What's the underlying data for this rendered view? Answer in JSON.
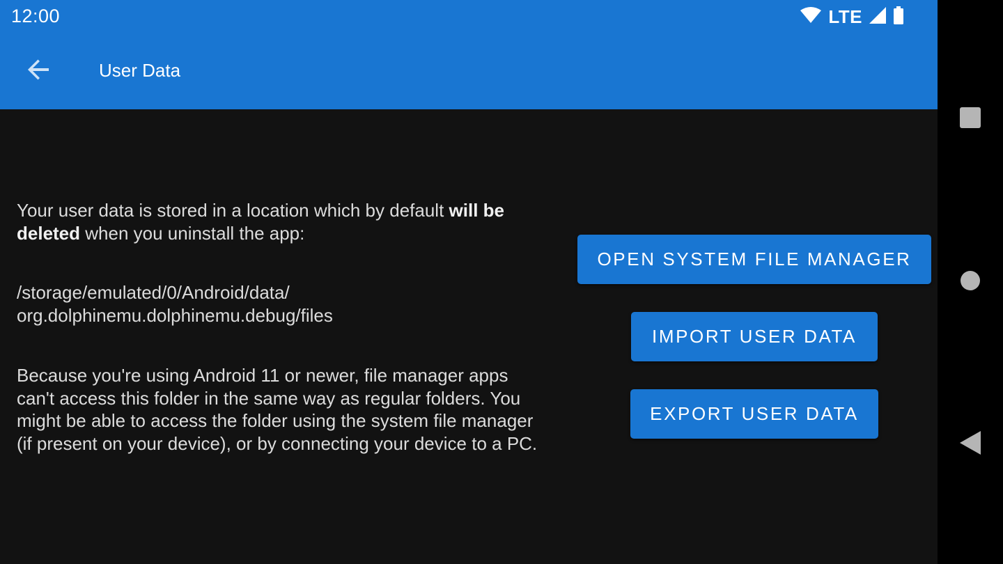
{
  "status_bar": {
    "time": "12:00",
    "network": "LTE",
    "icons": [
      "wifi-icon",
      "cellular-signal-icon",
      "battery-icon"
    ]
  },
  "app_bar": {
    "title": "User Data",
    "back_icon": "arrow-back-icon"
  },
  "content": {
    "intro_prefix": "Your user data is stored in a location which by default ",
    "intro_bold": "will be deleted",
    "intro_suffix": " when you uninstall the app:",
    "path_line1": "/storage/emulated/0/Android/data/",
    "path_line2": "org.dolphinemu.dolphinemu.debug/files",
    "android11_note": "Because you're using Android 11 or newer, file manager apps can't access this folder in the same way as regular folders. You might be able to access the folder using the system file manager (if present on your device), or by connecting your device to a PC."
  },
  "buttons": {
    "open_file_manager": "OPEN SYSTEM FILE MANAGER",
    "import_user_data": "IMPORT USER DATA",
    "export_user_data": "EXPORT USER DATA"
  },
  "nav_bar": {
    "icons": [
      "recent-apps-icon",
      "home-icon",
      "back-icon"
    ]
  },
  "colors": {
    "primary": "#1976d2",
    "background": "#121212",
    "text": "#dcdcdc"
  }
}
